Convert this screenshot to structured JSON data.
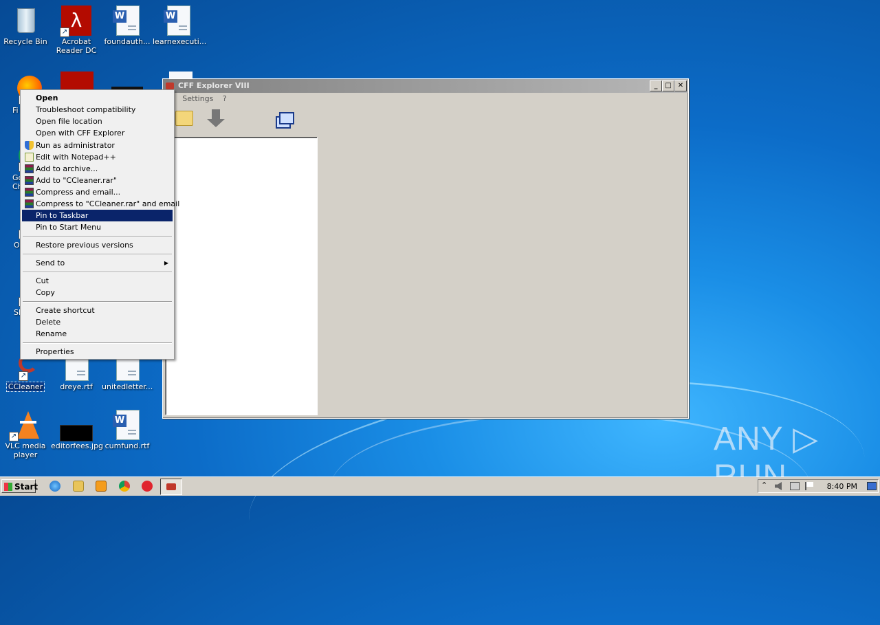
{
  "desktop": {
    "icons": [
      {
        "label": "Recycle Bin",
        "icon": "recycle-bin-icon"
      },
      {
        "label": "Acrobat Reader DC",
        "icon": "acrobat-icon"
      },
      {
        "label": "foundauth...",
        "icon": "word-doc-icon"
      },
      {
        "label": "learnexecuti...",
        "icon": "word-doc-icon"
      },
      {
        "label": "Fi",
        "icon": "firefox-icon"
      },
      {
        "label": "Go Ch",
        "icon": "chrome-icon"
      },
      {
        "label": "O",
        "icon": "opera-icon"
      },
      {
        "label": "Sk",
        "icon": "skype-icon"
      },
      {
        "label": "CCleaner",
        "icon": "ccleaner-icon"
      },
      {
        "label": "dreye.rtf",
        "icon": "word-doc-icon"
      },
      {
        "label": "unitedletter...",
        "icon": "word-doc-icon"
      },
      {
        "label": "VLC media player",
        "icon": "vlc-icon"
      },
      {
        "label": "editorfees.jpg",
        "icon": "image-icon"
      },
      {
        "label": "cumfund.rtf",
        "icon": "word-doc-icon"
      }
    ]
  },
  "window": {
    "title": "CFF Explorer VIII",
    "menu": [
      "e",
      "Settings",
      "?"
    ],
    "controls": {
      "minimize": "_",
      "maximize": "□",
      "close": "✕"
    }
  },
  "context_menu": {
    "items": [
      {
        "label": "Open",
        "bold": true
      },
      {
        "label": "Troubleshoot compatibility"
      },
      {
        "label": "Open file location"
      },
      {
        "label": "Open with CFF Explorer"
      },
      {
        "label": "Run as administrator",
        "icon": "shield-icon"
      },
      {
        "label": "Edit with Notepad++",
        "icon": "notepadpp-icon"
      },
      {
        "label": "Add to archive...",
        "icon": "winrar-icon"
      },
      {
        "label": "Add to \"CCleaner.rar\"",
        "icon": "winrar-icon"
      },
      {
        "label": "Compress and email...",
        "icon": "winrar-icon"
      },
      {
        "label": "Compress to \"CCleaner.rar\" and email",
        "icon": "winrar-icon"
      },
      {
        "label": "Pin to Taskbar",
        "highlighted": true
      },
      {
        "label": "Pin to Start Menu"
      },
      {
        "label": "Restore previous versions"
      },
      {
        "label": "Send to",
        "submenu": true
      },
      {
        "label": "Cut"
      },
      {
        "label": "Copy"
      },
      {
        "label": "Create shortcut"
      },
      {
        "label": "Delete"
      },
      {
        "label": "Rename"
      },
      {
        "label": "Properties"
      }
    ],
    "submenu_arrow": "▶"
  },
  "taskbar": {
    "start_label": "Start",
    "clock": "8:40 PM",
    "tray_arrow": "⌃"
  },
  "watermark": "ANY ▷ RUN",
  "colors": {
    "highlight": "#0a246a",
    "desktop": "#0c6cc8",
    "window_face": "#d4d0c8"
  }
}
